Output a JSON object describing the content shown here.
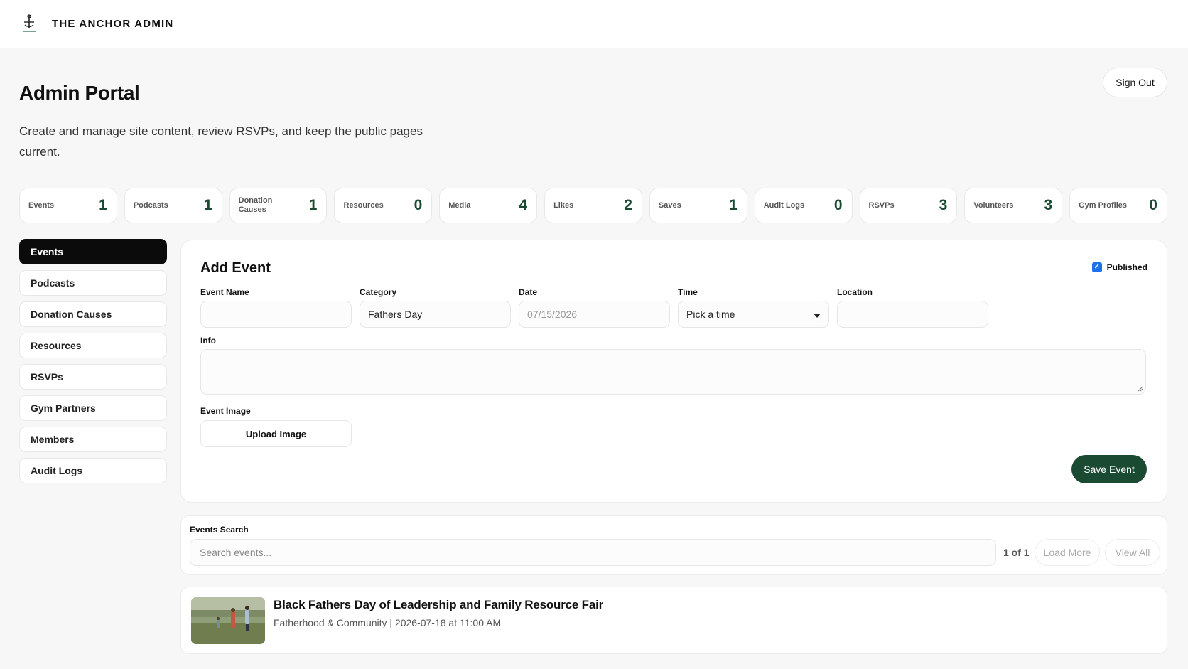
{
  "header": {
    "brand": "THE ANCHOR ADMIN"
  },
  "page": {
    "title": "Admin Portal",
    "subtitle": "Create and manage site content, review RSVPs, and keep the public pages current.",
    "sign_out_label": "Sign Out"
  },
  "stats": [
    {
      "label": "Events",
      "value": "1"
    },
    {
      "label": "Podcasts",
      "value": "1"
    },
    {
      "label": "Donation Causes",
      "value": "1"
    },
    {
      "label": "Resources",
      "value": "0"
    },
    {
      "label": "Media",
      "value": "4"
    },
    {
      "label": "Likes",
      "value": "2"
    },
    {
      "label": "Saves",
      "value": "1"
    },
    {
      "label": "Audit Logs",
      "value": "0"
    },
    {
      "label": "RSVPs",
      "value": "3"
    },
    {
      "label": "Volunteers",
      "value": "3"
    },
    {
      "label": "Gym Profiles",
      "value": "0"
    }
  ],
  "sidebar": {
    "items": [
      {
        "label": "Events",
        "active": true
      },
      {
        "label": "Podcasts"
      },
      {
        "label": "Donation Causes"
      },
      {
        "label": "Resources"
      },
      {
        "label": "RSVPs"
      },
      {
        "label": "Gym Partners"
      },
      {
        "label": "Members"
      },
      {
        "label": "Audit Logs"
      }
    ]
  },
  "form": {
    "title": "Add Event",
    "published_label": "Published",
    "published_checked": true,
    "event_name_label": "Event Name",
    "event_name_value": "",
    "category_label": "Category",
    "category_value": "Fathers Day",
    "date_label": "Date",
    "date_value": "07/15/2026",
    "time_label": "Time",
    "time_value": "Pick a time",
    "location_label": "Location",
    "location_value": "",
    "info_label": "Info",
    "info_value": "",
    "image_label": "Event Image",
    "upload_label": "Upload Image",
    "save_label": "Save Event"
  },
  "search": {
    "label": "Events Search",
    "placeholder": "Search events...",
    "page_count": "1 of 1",
    "load_more_label": "Load More",
    "view_all_label": "View All"
  },
  "events": [
    {
      "title": "Black Fathers Day of Leadership and Family Resource Fair",
      "meta": "Fatherhood & Community | 2026-07-18 at 11:00 AM"
    }
  ],
  "colors": {
    "accent": "#1b4a33",
    "active_nav": "#0b0b0b",
    "checkbox": "#1a73e8",
    "page_bg": "#f7f7f7"
  }
}
